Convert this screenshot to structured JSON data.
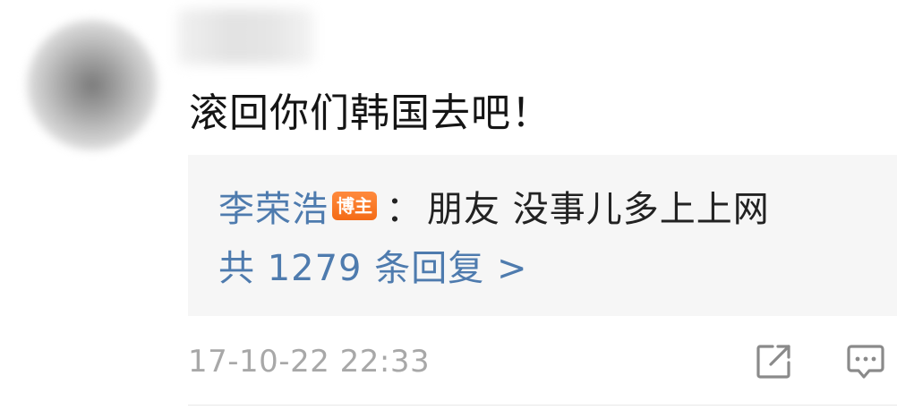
{
  "comment": {
    "avatar": "blurred-avatar",
    "username": "",
    "text": "滚回你们韩国去吧！"
  },
  "reply": {
    "author": "李荣浩",
    "badge": "博主",
    "colon": "：",
    "content": "朋友 没事儿多上上网",
    "count_text": "共 1279 条回复 >"
  },
  "footer": {
    "timestamp": "17-10-22 22:33",
    "share_icon": "share-icon",
    "reply_icon": "comment-icon"
  },
  "colors": {
    "link_blue": "#4e7bae",
    "badge_orange": "#f46b16",
    "muted_gray": "#a8a8a8",
    "reply_bg": "#f6f6f6"
  }
}
